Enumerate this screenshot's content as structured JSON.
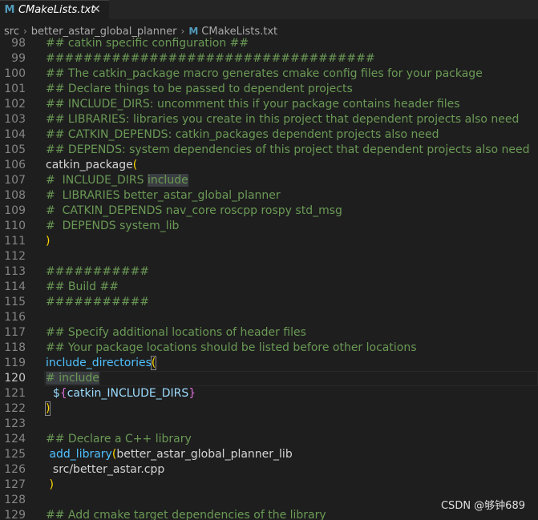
{
  "tab": {
    "icon": "M",
    "label": "CMakeLists.txt",
    "close": "✕"
  },
  "breadcrumb": [
    "src",
    "better_astar_global_planner",
    "CMakeLists.txt"
  ],
  "watermark": "CSDN @够钟689",
  "lines": [
    {
      "n": "98",
      "segs": [
        {
          "t": "## catkin specific configuration ##",
          "c": "comment"
        }
      ]
    },
    {
      "n": "99",
      "segs": [
        {
          "t": "###################################",
          "c": "comment"
        }
      ]
    },
    {
      "n": "100",
      "segs": [
        {
          "t": "## The catkin_package macro generates cmake config files for your package",
          "c": "comment"
        }
      ]
    },
    {
      "n": "101",
      "segs": [
        {
          "t": "## Declare things to be passed to dependent projects",
          "c": "comment"
        }
      ]
    },
    {
      "n": "102",
      "segs": [
        {
          "t": "## INCLUDE_DIRS: uncomment this if your package contains header files",
          "c": "comment"
        }
      ]
    },
    {
      "n": "103",
      "segs": [
        {
          "t": "## LIBRARIES: libraries you create in this project that dependent projects also need",
          "c": "comment"
        }
      ]
    },
    {
      "n": "104",
      "segs": [
        {
          "t": "## CATKIN_DEPENDS: catkin_packages dependent projects also need",
          "c": "comment"
        }
      ]
    },
    {
      "n": "105",
      "segs": [
        {
          "t": "## DEPENDS: system dependencies of this project that dependent projects also need",
          "c": "comment"
        }
      ]
    },
    {
      "n": "106",
      "segs": [
        {
          "t": "catkin_package",
          "c": "plain"
        },
        {
          "t": "(",
          "c": "paren"
        }
      ]
    },
    {
      "n": "107",
      "segs": [
        {
          "t": "#  INCLUDE_DIRS ",
          "c": "comment"
        },
        {
          "t": "include",
          "c": "comment-hl"
        }
      ]
    },
    {
      "n": "108",
      "segs": [
        {
          "t": "#  LIBRARIES better_astar_global_planner",
          "c": "comment"
        }
      ]
    },
    {
      "n": "109",
      "segs": [
        {
          "t": "#  CATKIN_DEPENDS nav_core roscpp rospy std_msg",
          "c": "comment"
        }
      ]
    },
    {
      "n": "110",
      "segs": [
        {
          "t": "#  DEPENDS system_lib",
          "c": "comment"
        }
      ]
    },
    {
      "n": "111",
      "segs": [
        {
          "t": ")",
          "c": "paren"
        }
      ]
    },
    {
      "n": "112",
      "segs": []
    },
    {
      "n": "113",
      "segs": [
        {
          "t": "###########",
          "c": "comment"
        }
      ]
    },
    {
      "n": "114",
      "segs": [
        {
          "t": "## Build ##",
          "c": "comment"
        }
      ]
    },
    {
      "n": "115",
      "segs": [
        {
          "t": "###########",
          "c": "comment"
        }
      ]
    },
    {
      "n": "116",
      "segs": []
    },
    {
      "n": "117",
      "segs": [
        {
          "t": "## Specify additional locations of header files",
          "c": "comment"
        }
      ]
    },
    {
      "n": "118",
      "segs": [
        {
          "t": "## Your package locations should be listed before other locations",
          "c": "comment"
        }
      ]
    },
    {
      "n": "119",
      "segs": [
        {
          "t": "include_directories",
          "c": "func-blue"
        },
        {
          "t": "(",
          "c": "paren-hl"
        }
      ]
    },
    {
      "n": "120",
      "active": true,
      "segs": [
        {
          "t": "# ",
          "c": "comment-hl"
        },
        {
          "t": "include",
          "c": "comment-hl"
        }
      ]
    },
    {
      "n": "121",
      "segs": [
        {
          "t": "  $",
          "c": "var"
        },
        {
          "t": "{",
          "c": "brace"
        },
        {
          "t": "catkin_INCLUDE_DIRS",
          "c": "var"
        },
        {
          "t": "}",
          "c": "brace"
        }
      ]
    },
    {
      "n": "122",
      "segs": [
        {
          "t": ")",
          "c": "paren-hl"
        }
      ]
    },
    {
      "n": "123",
      "segs": []
    },
    {
      "n": "124",
      "segs": [
        {
          "t": "## Declare a C++ library",
          "c": "comment"
        }
      ]
    },
    {
      "n": "125",
      "segs": [
        {
          "t": " add_library",
          "c": "func-blue"
        },
        {
          "t": "(",
          "c": "paren"
        },
        {
          "t": "better_astar_global_planner_lib",
          "c": "plain"
        }
      ]
    },
    {
      "n": "126",
      "segs": [
        {
          "t": "  src/better_astar.cpp",
          "c": "plain"
        }
      ]
    },
    {
      "n": "127",
      "segs": [
        {
          "t": " )",
          "c": "paren"
        }
      ]
    },
    {
      "n": "128",
      "segs": []
    },
    {
      "n": "129",
      "segs": [
        {
          "t": "## Add cmake target dependencies of the library",
          "c": "comment"
        }
      ]
    }
  ]
}
